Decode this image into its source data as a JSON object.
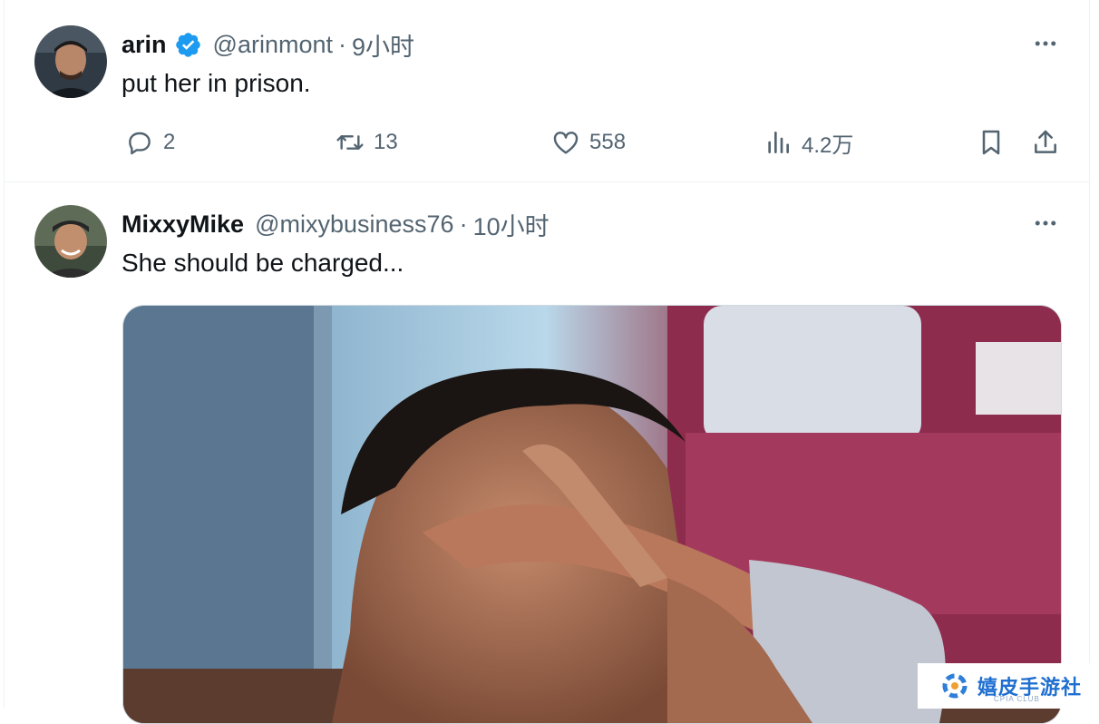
{
  "tweets": [
    {
      "name": "arin",
      "verified": true,
      "handle": "@arinmont",
      "separator": "·",
      "time": "9小时",
      "text": "put her in prison.",
      "actions": {
        "reply_count": "2",
        "retweet_count": "13",
        "like_count": "558",
        "views_count": "4.2万"
      }
    },
    {
      "name": "MixxyMike",
      "handle": "@mixybusiness76",
      "separator": "·",
      "time": "10小时",
      "text": "She should be charged..."
    }
  ],
  "watermark": {
    "text": "嬉皮手游社",
    "subtext": "CPIA CLUB"
  },
  "colors": {
    "accent": "#1d9bf0",
    "secondary_text": "#536471",
    "primary_text": "#0f1419",
    "border": "#eff3f4"
  },
  "icons": [
    "more-icon",
    "reply-icon",
    "retweet-icon",
    "like-icon",
    "views-icon",
    "bookmark-icon",
    "share-icon",
    "verified-icon"
  ]
}
